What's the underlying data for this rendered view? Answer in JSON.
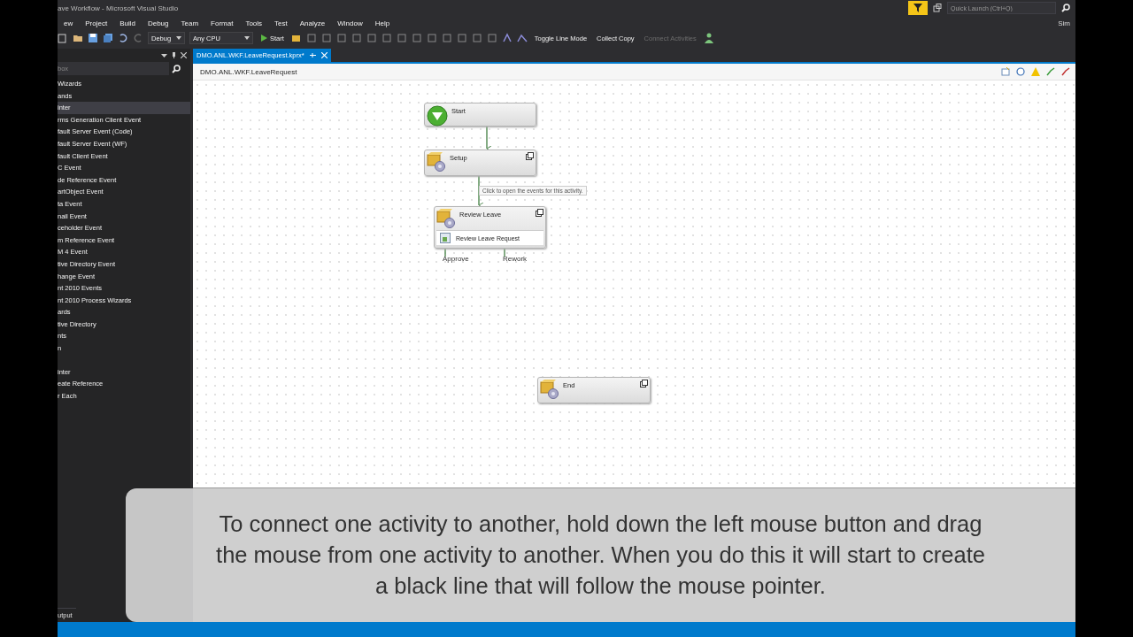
{
  "window": {
    "title": "ave Workflow - Microsoft Visual Studio"
  },
  "menu": [
    "ew",
    "Project",
    "Build",
    "Debug",
    "Team",
    "Format",
    "Tools",
    "Test",
    "Analyze",
    "Window",
    "Help"
  ],
  "toolbar": {
    "configuration": "Debug",
    "platform": "Any CPU",
    "start": "Start",
    "commands": [
      {
        "label": "Toggle Line Mode",
        "disabled": false
      },
      {
        "label": "Collect Copy",
        "disabled": false
      },
      {
        "label": "Connect Activities",
        "disabled": true
      }
    ]
  },
  "quick_launch": {
    "placeholder": "Quick Launch (Ctrl+Q)"
  },
  "user": "Sim",
  "toolbox": {
    "search": {
      "placeholder": "box"
    },
    "groups": [
      [
        {
          "label": "Wizards",
          "selected": false
        },
        {
          "label": "ands",
          "selected": false
        },
        {
          "label": "inter",
          "selected": true
        },
        {
          "label": "rms Generation Client Event",
          "selected": false
        },
        {
          "label": "fault Server Event (Code)",
          "selected": false
        },
        {
          "label": "fault Server Event (WF)",
          "selected": false
        },
        {
          "label": "fault Client Event",
          "selected": false
        },
        {
          "label": "C Event",
          "selected": false
        },
        {
          "label": "de Reference Event",
          "selected": false
        },
        {
          "label": "artObject Event",
          "selected": false
        },
        {
          "label": "ta Event",
          "selected": false
        },
        {
          "label": "nail Event",
          "selected": false
        },
        {
          "label": "ceholder Event",
          "selected": false
        },
        {
          "label": "m Reference Event",
          "selected": false
        },
        {
          "label": "M 4 Event",
          "selected": false
        },
        {
          "label": "tive Directory Event",
          "selected": false
        },
        {
          "label": "hange Event",
          "selected": false
        },
        {
          "label": "nt 2010 Events",
          "selected": false
        },
        {
          "label": "nt 2010 Process Wizards",
          "selected": false
        },
        {
          "label": "ards",
          "selected": false
        },
        {
          "label": "tive Directory",
          "selected": false
        },
        {
          "label": "nts",
          "selected": false
        },
        {
          "label": "n",
          "selected": false
        }
      ],
      [
        {
          "label": "inter",
          "selected": false
        },
        {
          "label": "eate Reference",
          "selected": false
        },
        {
          "label": "r Each",
          "selected": false
        }
      ]
    ],
    "bottom_tab": "utput"
  },
  "document": {
    "tab": {
      "label": "DMO.ANL.WKF.LeaveRequest.kprx*",
      "selected": true
    },
    "header": "DMO.ANL.WKF.LeaveRequest",
    "nodes": [
      {
        "kind": "start",
        "title": "Start"
      },
      {
        "kind": "activity",
        "title": "Setup"
      },
      {
        "kind": "activity",
        "title": "Review Leave",
        "events": [
          "Review Leave Request"
        ]
      },
      {
        "kind": "activity",
        "title": "End"
      }
    ],
    "tooltip": "Click to open the events for this activity.",
    "outcomes": [
      "Approve",
      "Rework"
    ]
  },
  "caption": "To connect one activity to another, hold down the left mouse button and drag the mouse from one activity to another. When you do this it will start to create a black line that will follow the mouse pointer."
}
